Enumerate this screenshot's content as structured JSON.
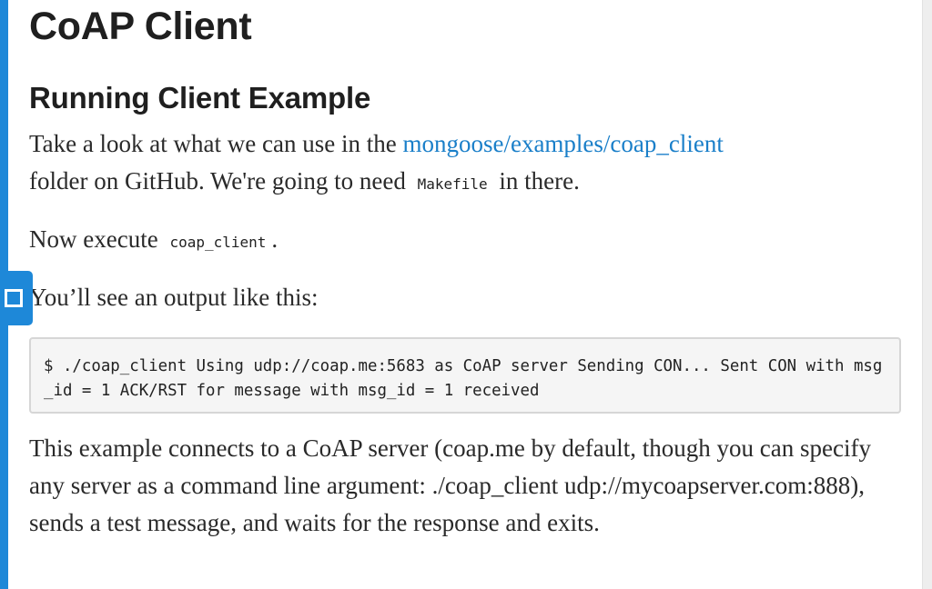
{
  "page": {
    "title": "CoAP Client"
  },
  "section": {
    "title": "Running Client Example"
  },
  "p1": {
    "lead": "Take a look at what we can use in the ",
    "link_text": "mongoose/examples/coap_client",
    "mid": " folder on GitHub. We're going to need ",
    "code": "Makefile",
    "tail": " in there."
  },
  "p2": {
    "lead": "Now execute ",
    "code": "coap_client",
    "tail": "."
  },
  "p3": {
    "text": "You’ll see an output like this:"
  },
  "code_block": {
    "text": "$ ./coap_client Using udp://coap.me:5683 as CoAP server Sending CON... Sent CON with msg_id = 1 ACK/RST for message with msg_id = 1 received"
  },
  "p4": {
    "text": "This example connects to a CoAP server (coap.me by default, though you can specify any server as a command line argument: ./coap_client udp://mycoapserver.com:888), sends a test message, and waits for the response and exits."
  },
  "anchor_tab": {
    "icon": "square-outline-icon"
  },
  "colors": {
    "accent": "#1e88d8",
    "link": "#1a7fc9",
    "code_bg": "#f5f5f5",
    "text": "#2a2a2a"
  }
}
